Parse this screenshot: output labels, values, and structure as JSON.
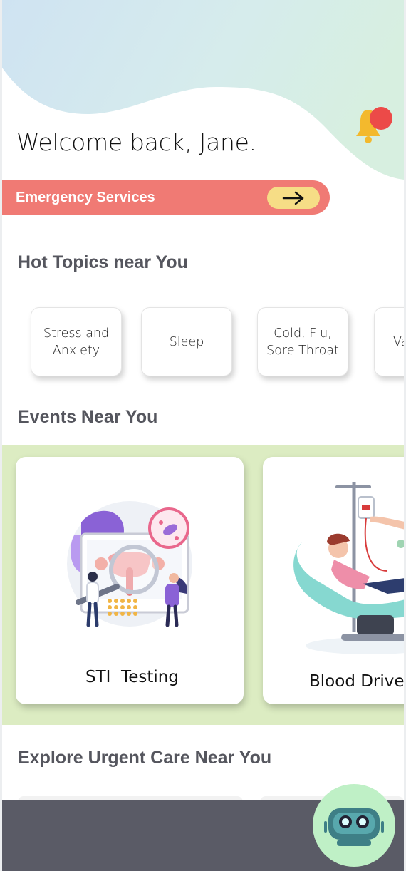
{
  "header": {
    "greeting": "Welcome back, Jane."
  },
  "icons": {
    "notifications": "bell-icon",
    "emergency_arrow": "arrow-right-icon",
    "assistant": "robot-icon"
  },
  "emergency": {
    "label": "Emergency Services"
  },
  "hot_topics": {
    "title": "Hot Topics near You",
    "items": [
      {
        "label": "Stress and Anxiety"
      },
      {
        "label": "Sleep"
      },
      {
        "label": "Cold, Flu, Sore Throat"
      },
      {
        "label": "Va"
      }
    ]
  },
  "events": {
    "title": "Events Near You",
    "items": [
      {
        "label": "STI  Testing"
      },
      {
        "label": "Blood Drive"
      }
    ]
  },
  "urgent_care": {
    "title": "Explore Urgent Care Near You"
  },
  "colors": {
    "emergency_bg": "#f07a74",
    "arrow_pill": "#f6dd86",
    "events_band": "#dcecc2",
    "bottom_bar": "#5a5b66",
    "assistant_bg": "#bff0c6",
    "bell_yellow": "#f3b92d",
    "badge_red": "#ec4a48"
  }
}
